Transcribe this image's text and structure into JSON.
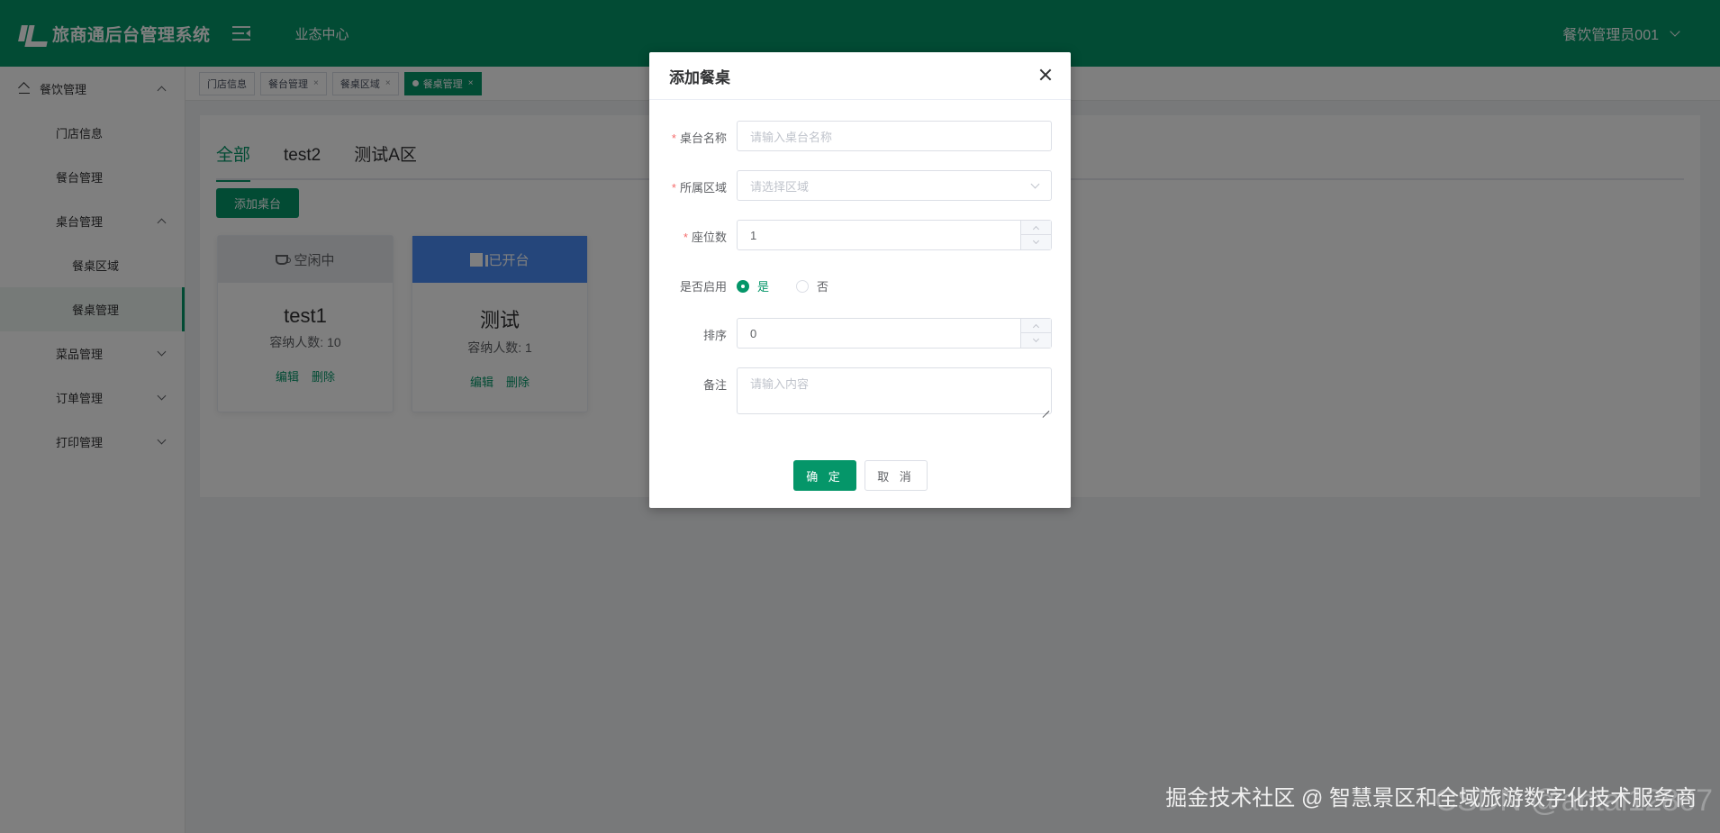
{
  "header": {
    "title": "旅商通后台管理系统",
    "nav": "业态中心",
    "user": "餐饮管理员001"
  },
  "sidebar": {
    "group": "餐饮管理",
    "items": [
      {
        "label": "门店信息"
      },
      {
        "label": "餐台管理"
      },
      {
        "label": "桌台管理"
      },
      {
        "label": "餐桌区域"
      },
      {
        "label": "餐桌管理"
      },
      {
        "label": "菜品管理"
      },
      {
        "label": "订单管理"
      },
      {
        "label": "打印管理"
      }
    ]
  },
  "tags": [
    {
      "label": "门店信息"
    },
    {
      "label": "餐台管理"
    },
    {
      "label": "餐桌区域"
    },
    {
      "label": "餐桌管理"
    }
  ],
  "tabs": [
    {
      "label": "全部"
    },
    {
      "label": "test2"
    },
    {
      "label": "测试A区"
    }
  ],
  "add_table_button": "添加桌台",
  "cards": [
    {
      "status": "空闲中",
      "name": "test1",
      "capacity": "容纳人数: 10",
      "edit": "编辑",
      "delete": "删除"
    },
    {
      "status": "已开台",
      "name": "测试",
      "capacity": "容纳人数: 1",
      "edit": "编辑",
      "delete": "删除"
    }
  ],
  "dialog": {
    "title": "添加餐桌",
    "fields": {
      "name": {
        "label": "桌台名称",
        "placeholder": "请输入桌台名称"
      },
      "area": {
        "label": "所属区域",
        "placeholder": "请选择区域"
      },
      "seats": {
        "label": "座位数",
        "value": "1"
      },
      "enabled": {
        "label": "是否启用",
        "options": [
          "是",
          "否"
        ],
        "selected": "是"
      },
      "sort": {
        "label": "排序",
        "value": "0"
      },
      "remark": {
        "label": "备注",
        "placeholder": "请输入内容"
      }
    },
    "confirm": "确 定",
    "cancel": "取 消"
  },
  "watermark": "掘金技术社区 @ 智慧景区和全域旅游数字化技术服务商",
  "watermark_ghost": "CSDN @antai12867",
  "colors": {
    "brand": "#059669",
    "busy": "#4a8cf7",
    "required": "#f56c6c"
  }
}
